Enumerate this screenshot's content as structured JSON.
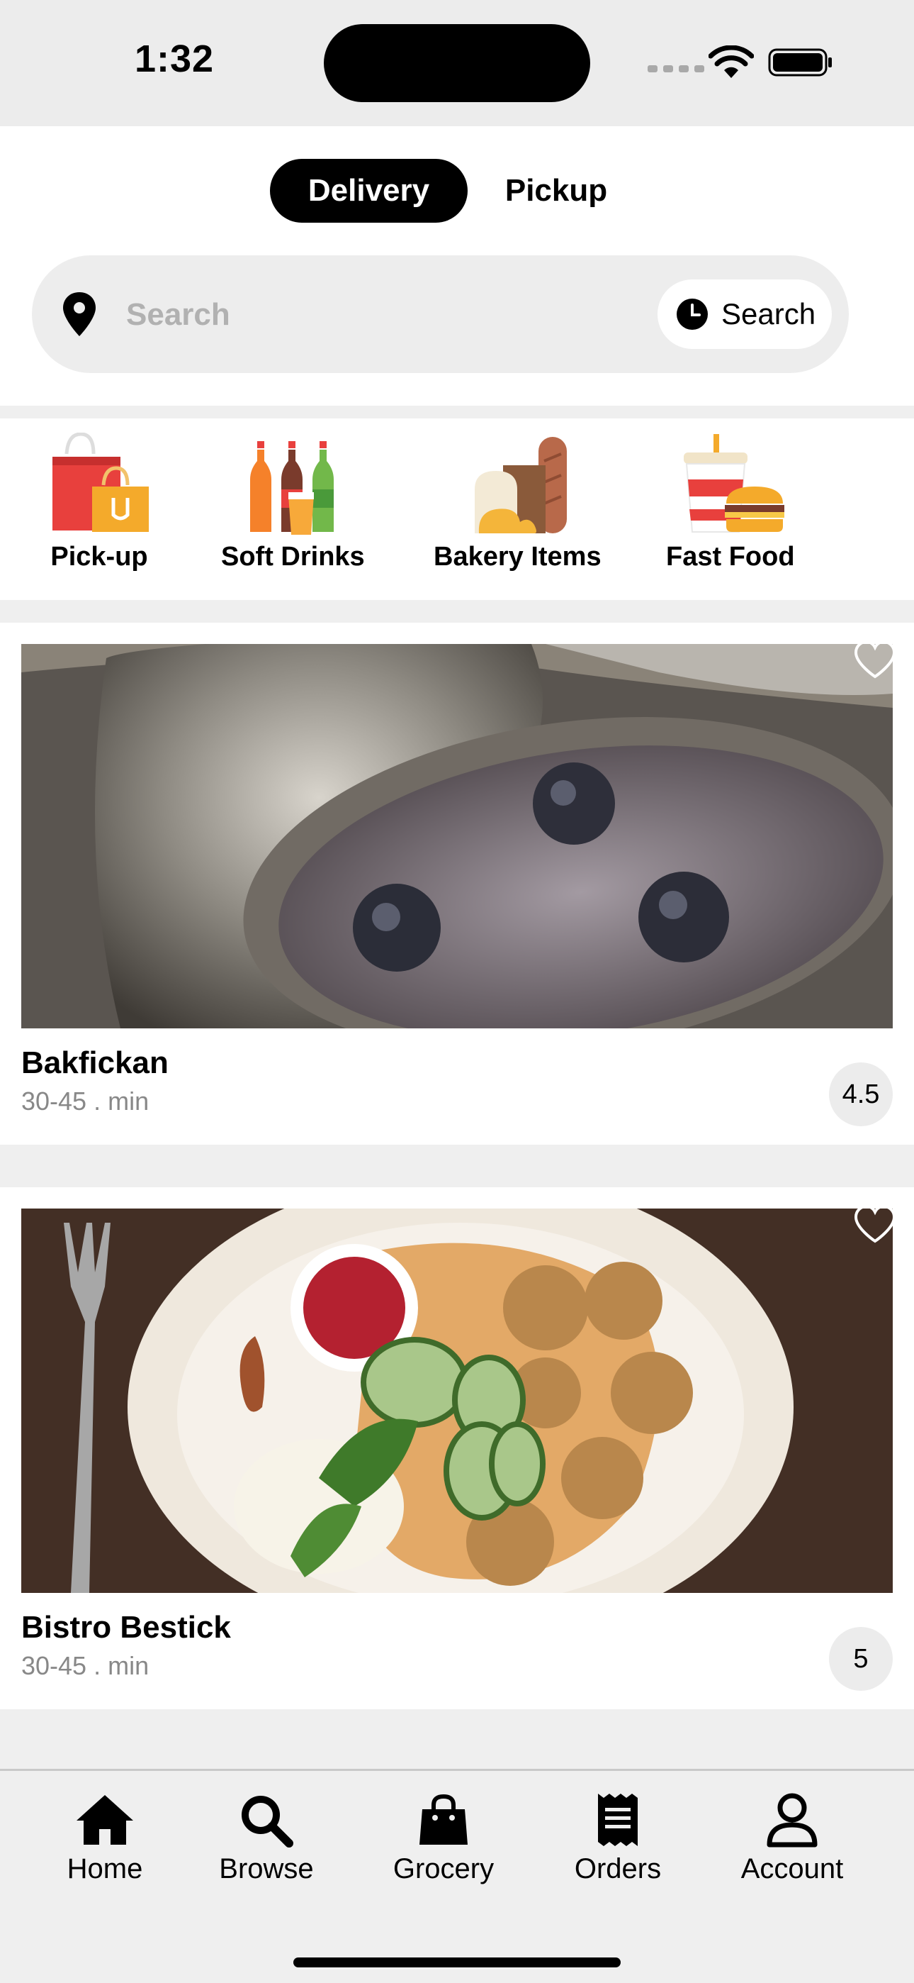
{
  "status_bar": {
    "time": "1:32"
  },
  "mode_toggle": {
    "delivery_label": "Delivery",
    "pickup_label": "Pickup",
    "selected": "Delivery"
  },
  "search": {
    "placeholder": "Search",
    "button_label": "Search"
  },
  "categories": [
    {
      "label": "Pick-up",
      "icon": "shopping-bags-icon"
    },
    {
      "label": "Soft Drinks",
      "icon": "soda-bottles-icon"
    },
    {
      "label": "Bakery Items",
      "icon": "bread-icon"
    },
    {
      "label": "Fast Food",
      "icon": "burger-drink-icon"
    }
  ],
  "restaurants": [
    {
      "name": "Bakfickan",
      "time": "30-45 . min",
      "rating": "4.5",
      "image": "blueberry-crumble-photo"
    },
    {
      "name": "Bistro Bestick",
      "time": "30-45 . min",
      "rating": "5",
      "image": "meatballs-plate-photo"
    }
  ],
  "tab_bar": {
    "items": [
      {
        "label": "Home",
        "icon": "home-icon"
      },
      {
        "label": "Browse",
        "icon": "search-icon"
      },
      {
        "label": "Grocery",
        "icon": "bag-icon"
      },
      {
        "label": "Orders",
        "icon": "receipt-icon"
      },
      {
        "label": "Account",
        "icon": "person-icon"
      }
    ]
  },
  "colors": {
    "accent": "#000000",
    "background": "#efefef",
    "card": "#ffffff",
    "muted_text": "#888888"
  }
}
